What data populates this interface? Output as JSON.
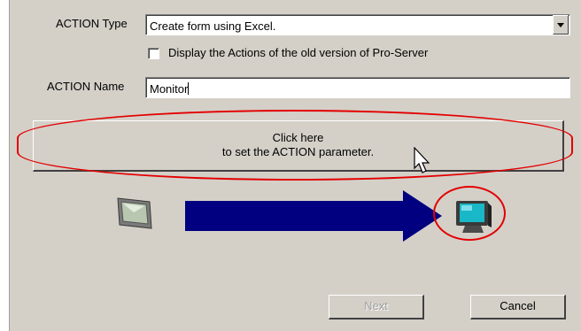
{
  "action_type": {
    "label": "ACTION Type",
    "value": "Create form using Excel."
  },
  "old_version": {
    "label": "Display the Actions of the old version of Pro-Server",
    "checked": false
  },
  "action_name": {
    "label": "ACTION Name",
    "value": "Monitor"
  },
  "set_param_button": {
    "line1": "Click here",
    "line2": "to set the ACTION parameter."
  },
  "flow": {
    "source_icon": "display-unit-icon",
    "arrow_icon": "arrow-right-icon",
    "target_icon": "monitor-icon"
  },
  "buttons": {
    "next": "Next",
    "next_enabled": false,
    "cancel": "Cancel"
  },
  "colors": {
    "highlight": "#e30000",
    "arrow": "#000080",
    "dialog": "#d4d0c8"
  }
}
